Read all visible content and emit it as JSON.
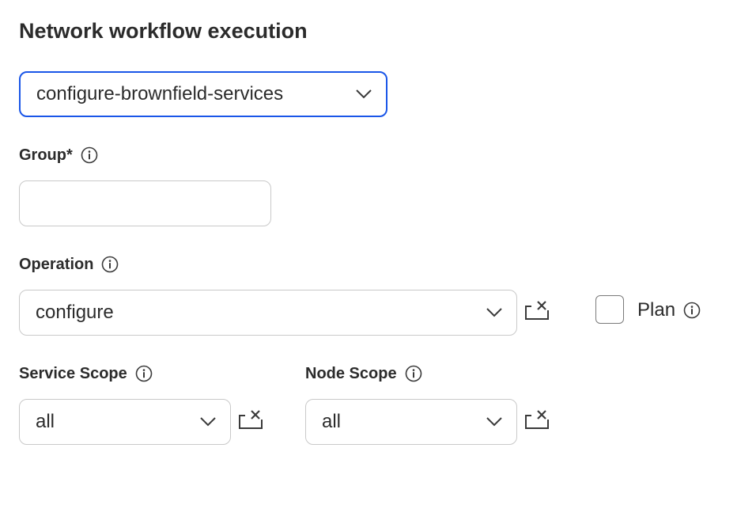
{
  "header": {
    "title": "Network workflow execution"
  },
  "workflow_select": {
    "value": "configure-brownfield-services"
  },
  "group": {
    "label": "Group*",
    "value": "",
    "placeholder": ""
  },
  "operation": {
    "label": "Operation",
    "value": "configure"
  },
  "plan": {
    "label": "Plan",
    "checked": false
  },
  "service_scope": {
    "label": "Service Scope",
    "value": "all"
  },
  "node_scope": {
    "label": "Node Scope",
    "value": "all"
  },
  "icons": {
    "dropdown": "chevron-down-icon",
    "info": "info-icon",
    "clear": "clear-field-icon"
  }
}
